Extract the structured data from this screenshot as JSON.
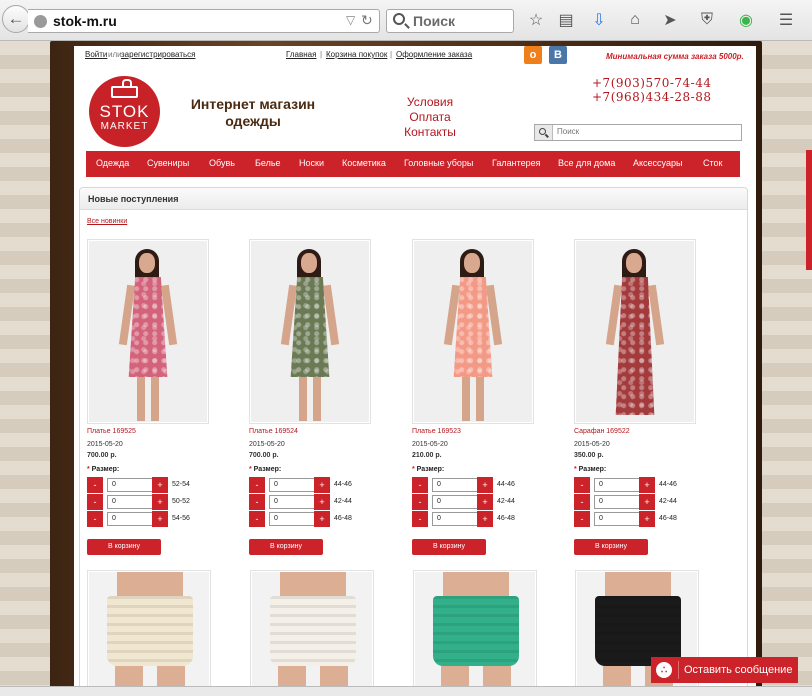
{
  "browser": {
    "url": "stok-m.ru",
    "search_placeholder": "Поиск",
    "toolbar_icons": [
      "star-icon",
      "reading-list-icon",
      "download-icon",
      "home-icon",
      "share-icon",
      "shield-icon",
      "extension-icon",
      "menu-icon"
    ]
  },
  "topbar": {
    "login": "Войти",
    "or": "или",
    "register": "зарегистрироваться",
    "links": [
      "Главная",
      "Корзина покупок",
      "Оформление заказа"
    ],
    "social": [
      "ok-icon",
      "vk-icon"
    ],
    "min_order": "Минимальная сумма заказа 5000р."
  },
  "header": {
    "logo_top": "STOK",
    "logo_bottom": "MARKET",
    "shop_name": "Интернет магазин одежды",
    "info_links": [
      "Условия",
      "Оплата",
      "Контакты"
    ],
    "phones": [
      "+7(903)570-74-44",
      "+7(968)434-28-88"
    ],
    "search_placeholder": "Поиск"
  },
  "nav": [
    "Одежда",
    "Сувениры",
    "Обувь",
    "Белье",
    "Носки",
    "Косметика",
    "Головные уборы",
    "Галантерея",
    "Все для дома",
    "Аксессуары",
    "Сток"
  ],
  "panel": {
    "title": "Новые поступления",
    "all_link": "Все новинки",
    "size_label": "Размер:",
    "cart_label": "В корзину",
    "minus": "-",
    "plus": "+",
    "products": [
      {
        "name": "Платье 169525",
        "date": "2015-05-20",
        "price": "700.00 р.",
        "sizes": [
          {
            "qty": "0",
            "size": "52-54"
          },
          {
            "qty": "0",
            "size": "50-52"
          },
          {
            "qty": "0",
            "size": "54-56"
          }
        ],
        "dress_color": "#d2637a"
      },
      {
        "name": "Платье 169524",
        "date": "2015-05-20",
        "price": "700.00 р.",
        "sizes": [
          {
            "qty": "0",
            "size": "44-46"
          },
          {
            "qty": "0",
            "size": "42-44"
          },
          {
            "qty": "0",
            "size": "46-48"
          }
        ],
        "dress_color": "#6b7a55"
      },
      {
        "name": "Платье 169523",
        "date": "2015-05-20",
        "price": "210.00 р.",
        "sizes": [
          {
            "qty": "0",
            "size": "44-46"
          },
          {
            "qty": "0",
            "size": "42-44"
          },
          {
            "qty": "0",
            "size": "46-48"
          }
        ],
        "dress_color": "#f39a86"
      },
      {
        "name": "Сарафан 169522",
        "date": "2015-05-20",
        "price": "350.00 р.",
        "sizes": [
          {
            "qty": "0",
            "size": "44-46"
          },
          {
            "qty": "0",
            "size": "42-44"
          },
          {
            "qty": "0",
            "size": "46-48"
          }
        ],
        "dress_color": "#a33a3c"
      }
    ],
    "shorts": [
      {
        "color": "#f1e6cf",
        "label": "shorts-cream"
      },
      {
        "color": "#f4f0e8",
        "label": "shorts-white"
      },
      {
        "color": "#32b08a",
        "label": "shorts-green"
      },
      {
        "color": "#1b1a1a",
        "label": "shorts-black"
      }
    ]
  },
  "chat": {
    "label": "Оставить сообщение"
  }
}
